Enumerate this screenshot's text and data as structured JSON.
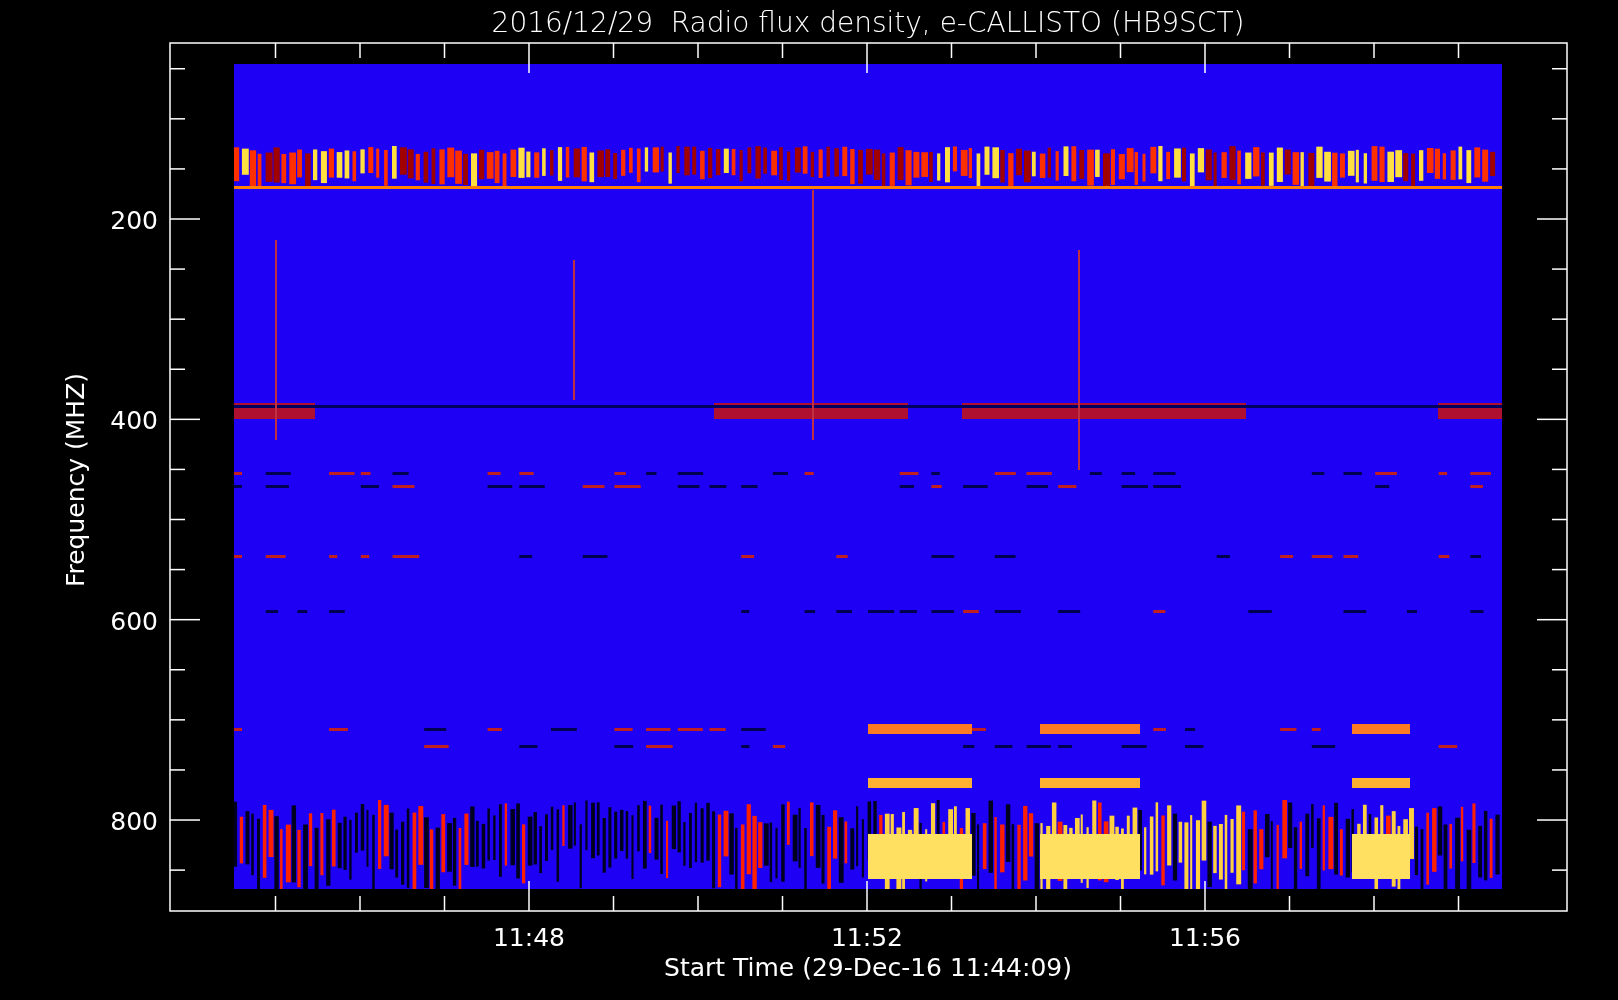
{
  "plot": {
    "title": "2016/12/29  Radio flux density, e-CALLISTO (HB9SCT)",
    "y_axis": {
      "label": "Frequency (MHZ)",
      "tick_labels": [
        "200",
        "400",
        "600",
        "800"
      ]
    },
    "x_axis": {
      "label": "Start Time (29-Dec-16 11:44:09)",
      "tick_labels": [
        "11:48",
        "11:52",
        "11:56"
      ]
    }
  }
}
